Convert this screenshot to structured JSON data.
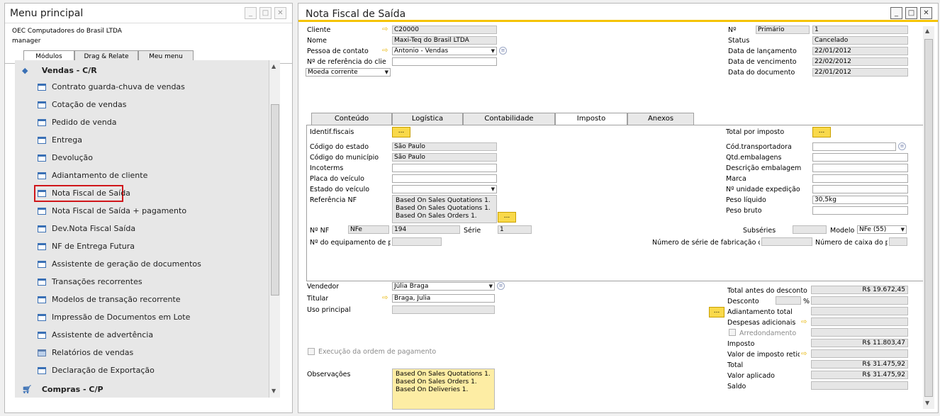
{
  "left": {
    "title": "Menu principal",
    "company": "OEC Computadores do Brasil LTDA",
    "user": "manager",
    "tabs": [
      "Módulos",
      "Drag & Relate",
      "Meu menu"
    ],
    "group1": "Vendas - C/R",
    "items": [
      "Contrato guarda-chuva de vendas",
      "Cotação de vendas",
      "Pedido de venda",
      "Entrega",
      "Devolução",
      "Adiantamento de cliente",
      "Nota Fiscal de Saída",
      "Nota Fiscal de Saída + pagamento",
      "Dev.Nota Fiscal Saída",
      "NF de Entrega Futura",
      "Assistente de geração de documentos",
      "Transações recorrentes",
      "Modelos de transação recorrente",
      "Impressão de Documentos em Lote",
      "Assistente de advertência",
      "Relatórios de vendas",
      "Declaração de Exportação"
    ],
    "group2": "Compras - C/P"
  },
  "right": {
    "title": "Nota Fiscal de Saída",
    "header": {
      "cliente_l": "Cliente",
      "cliente_v": "C20000",
      "nome_l": "Nome",
      "nome_v": "Maxi-Teq do Brasil LTDA",
      "contato_l": "Pessoa de contato",
      "contato_v": "Antonio - Vendas",
      "ref_l": "Nº de referência do clie",
      "moeda_v": "Moeda corrente",
      "no_l": "Nº",
      "no_series": "Primário",
      "no_v": "1",
      "status_l": "Status",
      "status_v": "Cancelado",
      "lanc_l": "Data de lançamento",
      "lanc_v": "22/01/2012",
      "venc_l": "Data de vencimento",
      "venc_v": "22/02/2012",
      "doc_l": "Data do documento",
      "doc_v": "22/01/2012"
    },
    "tabs": [
      "Conteúdo",
      "Logística",
      "Contabilidade",
      "Imposto",
      "Anexos"
    ],
    "imposto": {
      "idfisc": "Identif.fiscais",
      "cod_est_l": "Código do estado",
      "cod_est_v": "São Paulo",
      "cod_mun_l": "Código do município",
      "cod_mun_v": "São Paulo",
      "incoterms": "Incoterms",
      "placa": "Placa do veículo",
      "estado_veic": "Estado do veículo",
      "ref_nf": "Referência NF",
      "ref_nf_list": [
        "Based On Sales Quotations 1.",
        "Based On Sales Quotations 1.",
        "Based On Sales Orders 1."
      ],
      "no_nf_l": "Nº NF",
      "no_nf_type": "NFe",
      "no_nf_v": "194",
      "serie_l": "Série",
      "serie_v": "1",
      "subseries_l": "Subséries",
      "modelo_l": "Modelo",
      "modelo_v": "NFe (55)",
      "equip_l": "Nº do equipamento de pc",
      "num_serie_l": "Número de série de fabricação do",
      "num_caixa_l": "Número de caixa do pc",
      "total_imp_l": "Total por imposto",
      "transp_l": "Cód.transportadora",
      "qtd_emb_l": "Qtd.embalagens",
      "desc_emb_l": "Descrição embalagem",
      "marca_l": "Marca",
      "no_exp_l": "Nº unidade expedição",
      "peso_liq_l": "Peso líquido",
      "peso_liq_v": "30,5kg",
      "peso_bruto_l": "Peso bruto"
    },
    "footer": {
      "vendedor_l": "Vendedor",
      "vendedor_v": "Júlia Braga",
      "titular_l": "Titular",
      "titular_v": "Braga, Julia",
      "uso_l": "Uso principal",
      "exec_l": "Execução da ordem de pagamento",
      "obs_l": "Observações",
      "obs_lines": [
        "Based On Sales Quotations 1.",
        "Based On Sales Orders 1.",
        "Based On Deliveries 1."
      ],
      "total_antes_l": "Total antes do desconto",
      "total_antes_v": "R$ 19.672,45",
      "desconto_l": "Desconto",
      "pct": "%",
      "adiant_l": "Adiantamento total",
      "desp_l": "Despesas adicionais",
      "arred_l": "Arredondamento",
      "imposto_l": "Imposto",
      "imposto_v": "R$ 11.803,47",
      "retido_l": "Valor de imposto retido",
      "total_l": "Total",
      "total_v": "R$ 31.475,92",
      "aplicado_l": "Valor aplicado",
      "aplicado_v": "R$ 31.475,92",
      "saldo_l": "Saldo"
    }
  },
  "icons": {
    "dots": "...",
    "arrow": "⇨",
    "info": "≡"
  },
  "colors": {
    "accent": "#f5c300",
    "highlight": "#d0161a",
    "readonly": "#e6e6e6",
    "note": "#fdeda4"
  }
}
